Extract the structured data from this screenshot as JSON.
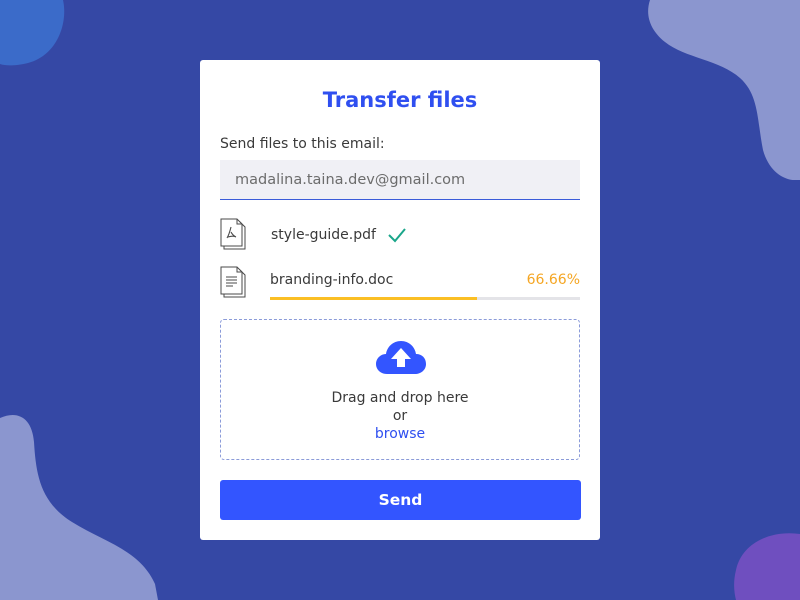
{
  "colors": {
    "background": "#3548a5",
    "accent": "#2f4ff0",
    "button": "#3355ff",
    "progress": "#fbbf24",
    "percent_text": "#f5a623",
    "success": "#1aa68a"
  },
  "card": {
    "title": "Transfer files",
    "email_label": "Send files to this email:",
    "email_value": "madalina.taina.dev@gmail.com",
    "files": [
      {
        "name": "style-guide.pdf",
        "icon": "pdf-file-icon",
        "status": "complete",
        "status_icon": "checkmark-icon"
      },
      {
        "name": "branding-info.doc",
        "icon": "doc-file-icon",
        "status": "uploading",
        "progress_label": "66.66%",
        "progress": 0.6666
      }
    ],
    "dropzone": {
      "icon": "cloud-upload-icon",
      "text": "Drag and drop here",
      "or_text": "or",
      "browse_label": "browse"
    },
    "send_label": "Send"
  }
}
